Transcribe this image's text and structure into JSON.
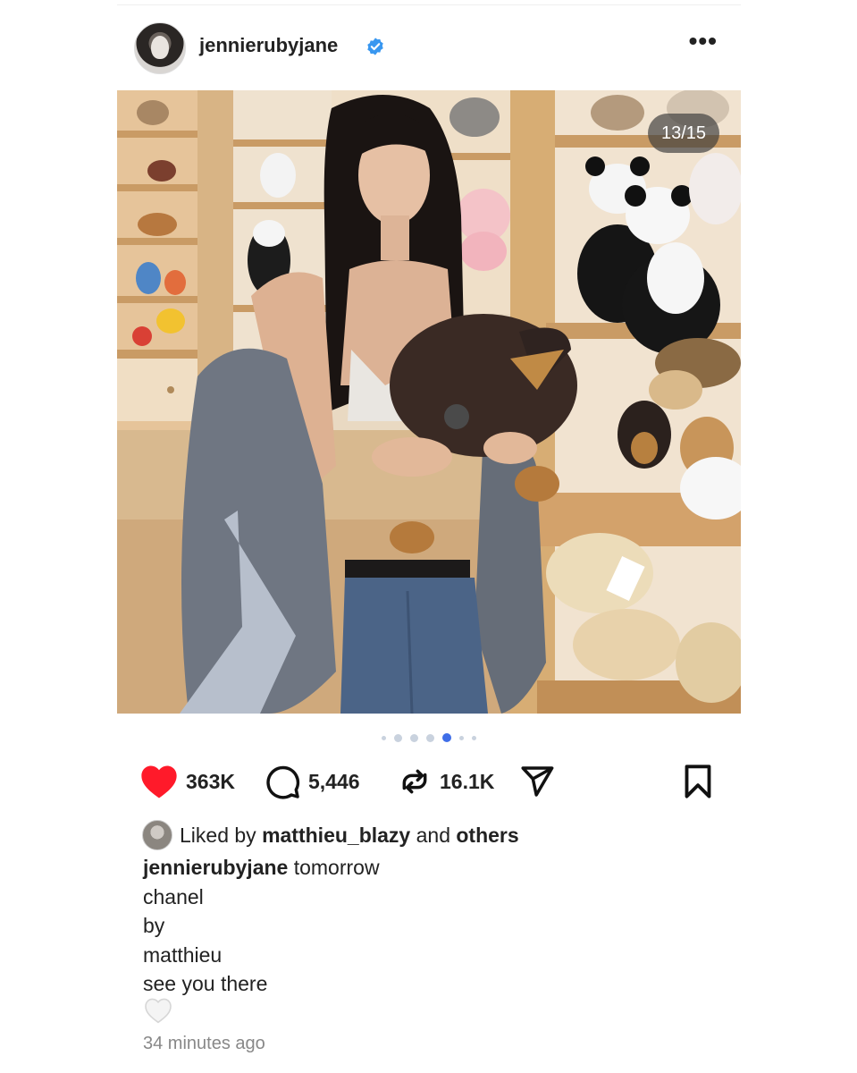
{
  "post": {
    "username": "jennierubyjane",
    "verified_icon": "verified-badge-icon",
    "more_icon": "more-options-icon",
    "more_label": "•••",
    "image_counter": "13/15",
    "carousel": {
      "total_dots": 7,
      "active_index": 4
    },
    "actions": {
      "like_count": "363K",
      "comment_count": "5,446",
      "repost_count": "16.1K",
      "like_icon": "heart-filled-icon",
      "comment_icon": "comment-bubble-icon",
      "repost_icon": "repost-icon",
      "share_icon": "send-icon",
      "save_icon": "bookmark-icon"
    },
    "likes": {
      "prefix": "Liked by",
      "user": "matthieu_blazy",
      "connector": "and",
      "others": "others"
    },
    "caption": {
      "author": "jennierubyjane",
      "first_line": "tomorrow",
      "lines": [
        "chanel",
        "by",
        "matthieu",
        "see you there"
      ]
    },
    "timestamp": "34 minutes ago"
  },
  "colors": {
    "like_red": "#ff1a2a",
    "active_dot": "#3f6ee8",
    "verified_blue": "#3897f0",
    "muted_text": "#888888"
  }
}
